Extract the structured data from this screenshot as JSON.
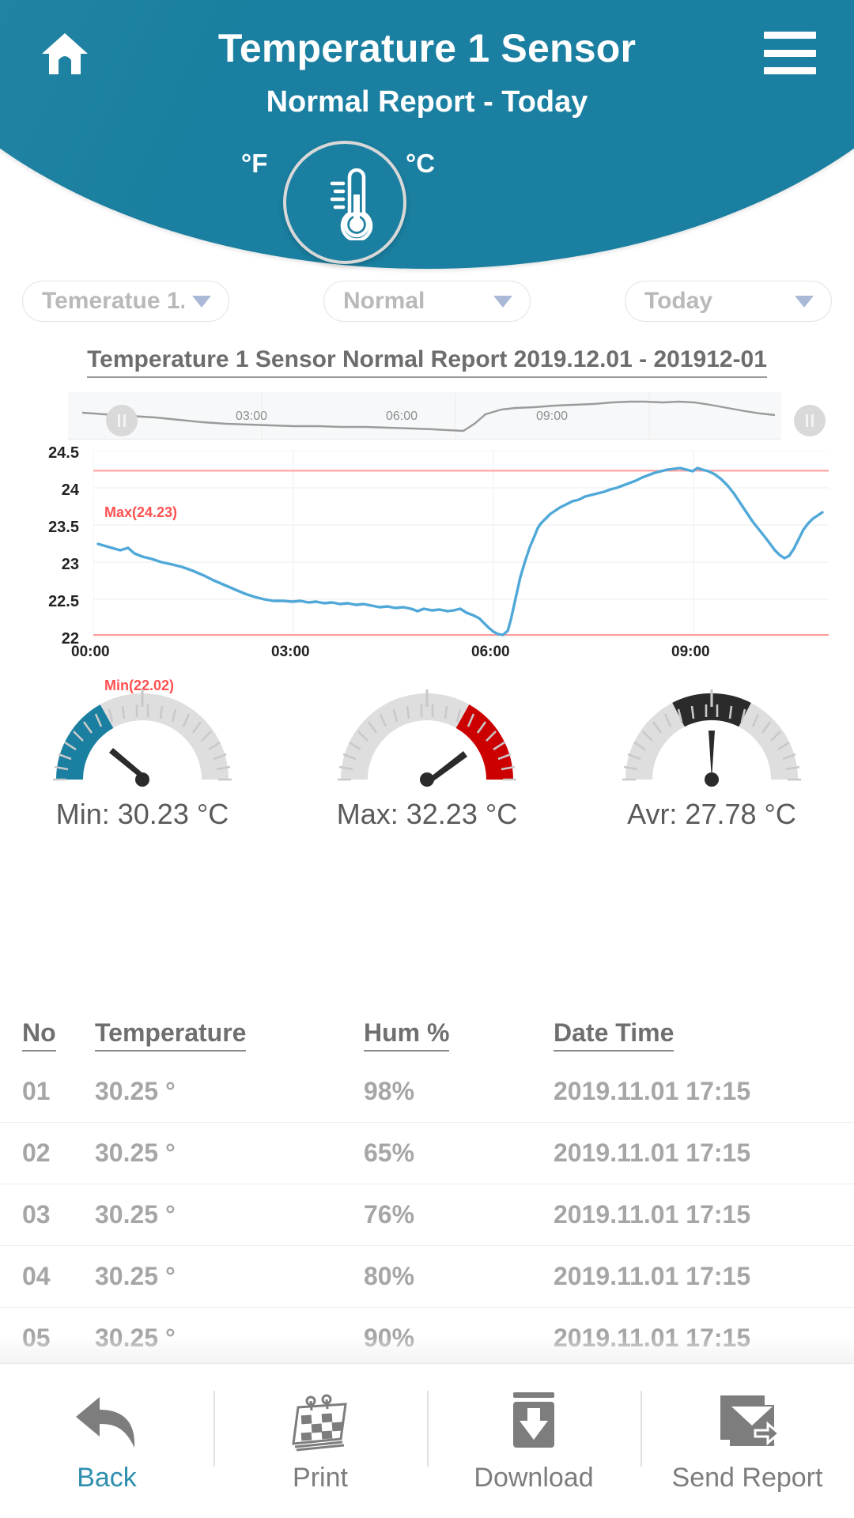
{
  "header": {
    "title": "Temperature 1 Sensor",
    "subtitle": "Normal Report  -  Today",
    "unit_f": "°F",
    "unit_c": "°C",
    "home_icon": "home-icon",
    "menu_icon": "hamburger-menu-icon",
    "thermometer_icon": "thermometer-icon",
    "brand_color": "#1a7fa0"
  },
  "filters": {
    "sensor": {
      "label": "Temeratue 1..",
      "caret": "chevron-down-icon"
    },
    "report_type": {
      "label": "Normal",
      "caret": "chevron-down-icon"
    },
    "period": {
      "label": "Today",
      "caret": "chevron-down-icon"
    }
  },
  "report": {
    "title": "Temperature 1 Sensor  Normal  Report  2019.12.01  - 201912-01"
  },
  "chart_data": {
    "type": "line",
    "title": "Temperature 1 Sensor  Normal  Report  2019.12.01  - 201912-01",
    "xlabel": "",
    "ylabel": "",
    "ylim": [
      22,
      24.5
    ],
    "yticks": [
      "22",
      "22.5",
      "23",
      "23.5",
      "24",
      "24.5"
    ],
    "xticks": [
      "00:00",
      "03:00",
      "06:00",
      "09:00"
    ],
    "navigator_xticks": [
      "03:00",
      "06:00",
      "09:00"
    ],
    "grid": true,
    "legend": false,
    "series_color": "#4fa8d8",
    "annotations": [
      {
        "name": "max-line",
        "label": "Max(24.23)",
        "value": 24.23,
        "color": "#ff5050"
      },
      {
        "name": "min-line",
        "label": "Min(22.02)",
        "value": 22.02,
        "color": "#ff5050"
      }
    ],
    "series": [
      {
        "name": "Temperature",
        "x": [
          "00:00",
          "00:15",
          "00:30",
          "00:45",
          "01:00",
          "01:15",
          "01:30",
          "01:45",
          "02:00",
          "02:15",
          "02:30",
          "02:45",
          "03:00",
          "03:15",
          "03:30",
          "03:45",
          "04:00",
          "04:15",
          "04:30",
          "04:45",
          "05:00",
          "05:15",
          "05:30",
          "05:45",
          "06:00",
          "06:10",
          "06:20",
          "06:30",
          "06:45",
          "07:00",
          "07:15",
          "07:30",
          "07:45",
          "08:00",
          "08:15",
          "08:30",
          "08:45",
          "09:00",
          "09:15",
          "09:30",
          "09:45",
          "10:00",
          "10:15",
          "10:30",
          "10:45",
          "11:00"
        ],
        "values": [
          23.37,
          23.33,
          23.28,
          23.22,
          23.16,
          23.1,
          23.04,
          22.99,
          22.9,
          22.8,
          22.7,
          22.6,
          22.52,
          22.5,
          22.48,
          22.46,
          22.44,
          22.42,
          22.4,
          22.38,
          22.36,
          22.34,
          22.3,
          22.22,
          22.12,
          22.03,
          22.02,
          22.35,
          23.1,
          23.62,
          23.95,
          24.02,
          24.06,
          24.12,
          24.18,
          24.23,
          24.18,
          24.2,
          24.12,
          23.86,
          23.55,
          23.25,
          23.0,
          22.92,
          23.2,
          23.56
        ]
      }
    ]
  },
  "gauges": [
    {
      "name": "min-gauge",
      "label": "Min: 30.23 °C",
      "value": 30.23,
      "arc_color": "#1a7fa0",
      "arc_side": "left",
      "needle_angle": -55
    },
    {
      "name": "max-gauge",
      "label": "Max: 32.23 °C",
      "value": 32.23,
      "arc_color": "#cc0000",
      "arc_side": "right",
      "needle_angle": 55
    },
    {
      "name": "avr-gauge",
      "label": "Avr: 27.78 °C",
      "value": 27.78,
      "arc_color": "#2b2b2b",
      "arc_side": "top",
      "needle_angle": 0
    }
  ],
  "table": {
    "columns": [
      "No",
      "Temperature",
      "Hum %",
      "Date Time"
    ],
    "rows": [
      {
        "no": "01",
        "temperature": "30.25 °",
        "hum": "98%",
        "datetime": "2019.11.01 17:15"
      },
      {
        "no": "02",
        "temperature": "30.25 °",
        "hum": "65%",
        "datetime": "2019.11.01 17:15"
      },
      {
        "no": "03",
        "temperature": "30.25 °",
        "hum": "76%",
        "datetime": "2019.11.01 17:15"
      },
      {
        "no": "04",
        "temperature": "30.25 °",
        "hum": "80%",
        "datetime": "2019.11.01 17:15"
      },
      {
        "no": "05",
        "temperature": "30.25 °",
        "hum": "90%",
        "datetime": "2019.11.01 17:15"
      }
    ]
  },
  "bottom_bar": {
    "items": [
      {
        "label": "Back",
        "icon": "back-arrow-icon",
        "active": true
      },
      {
        "label": "Print",
        "icon": "print-calendar-icon",
        "active": false
      },
      {
        "label": "Download",
        "icon": "download-icon",
        "active": false
      },
      {
        "label": "Send Report",
        "icon": "send-mail-icon",
        "active": false
      }
    ]
  }
}
